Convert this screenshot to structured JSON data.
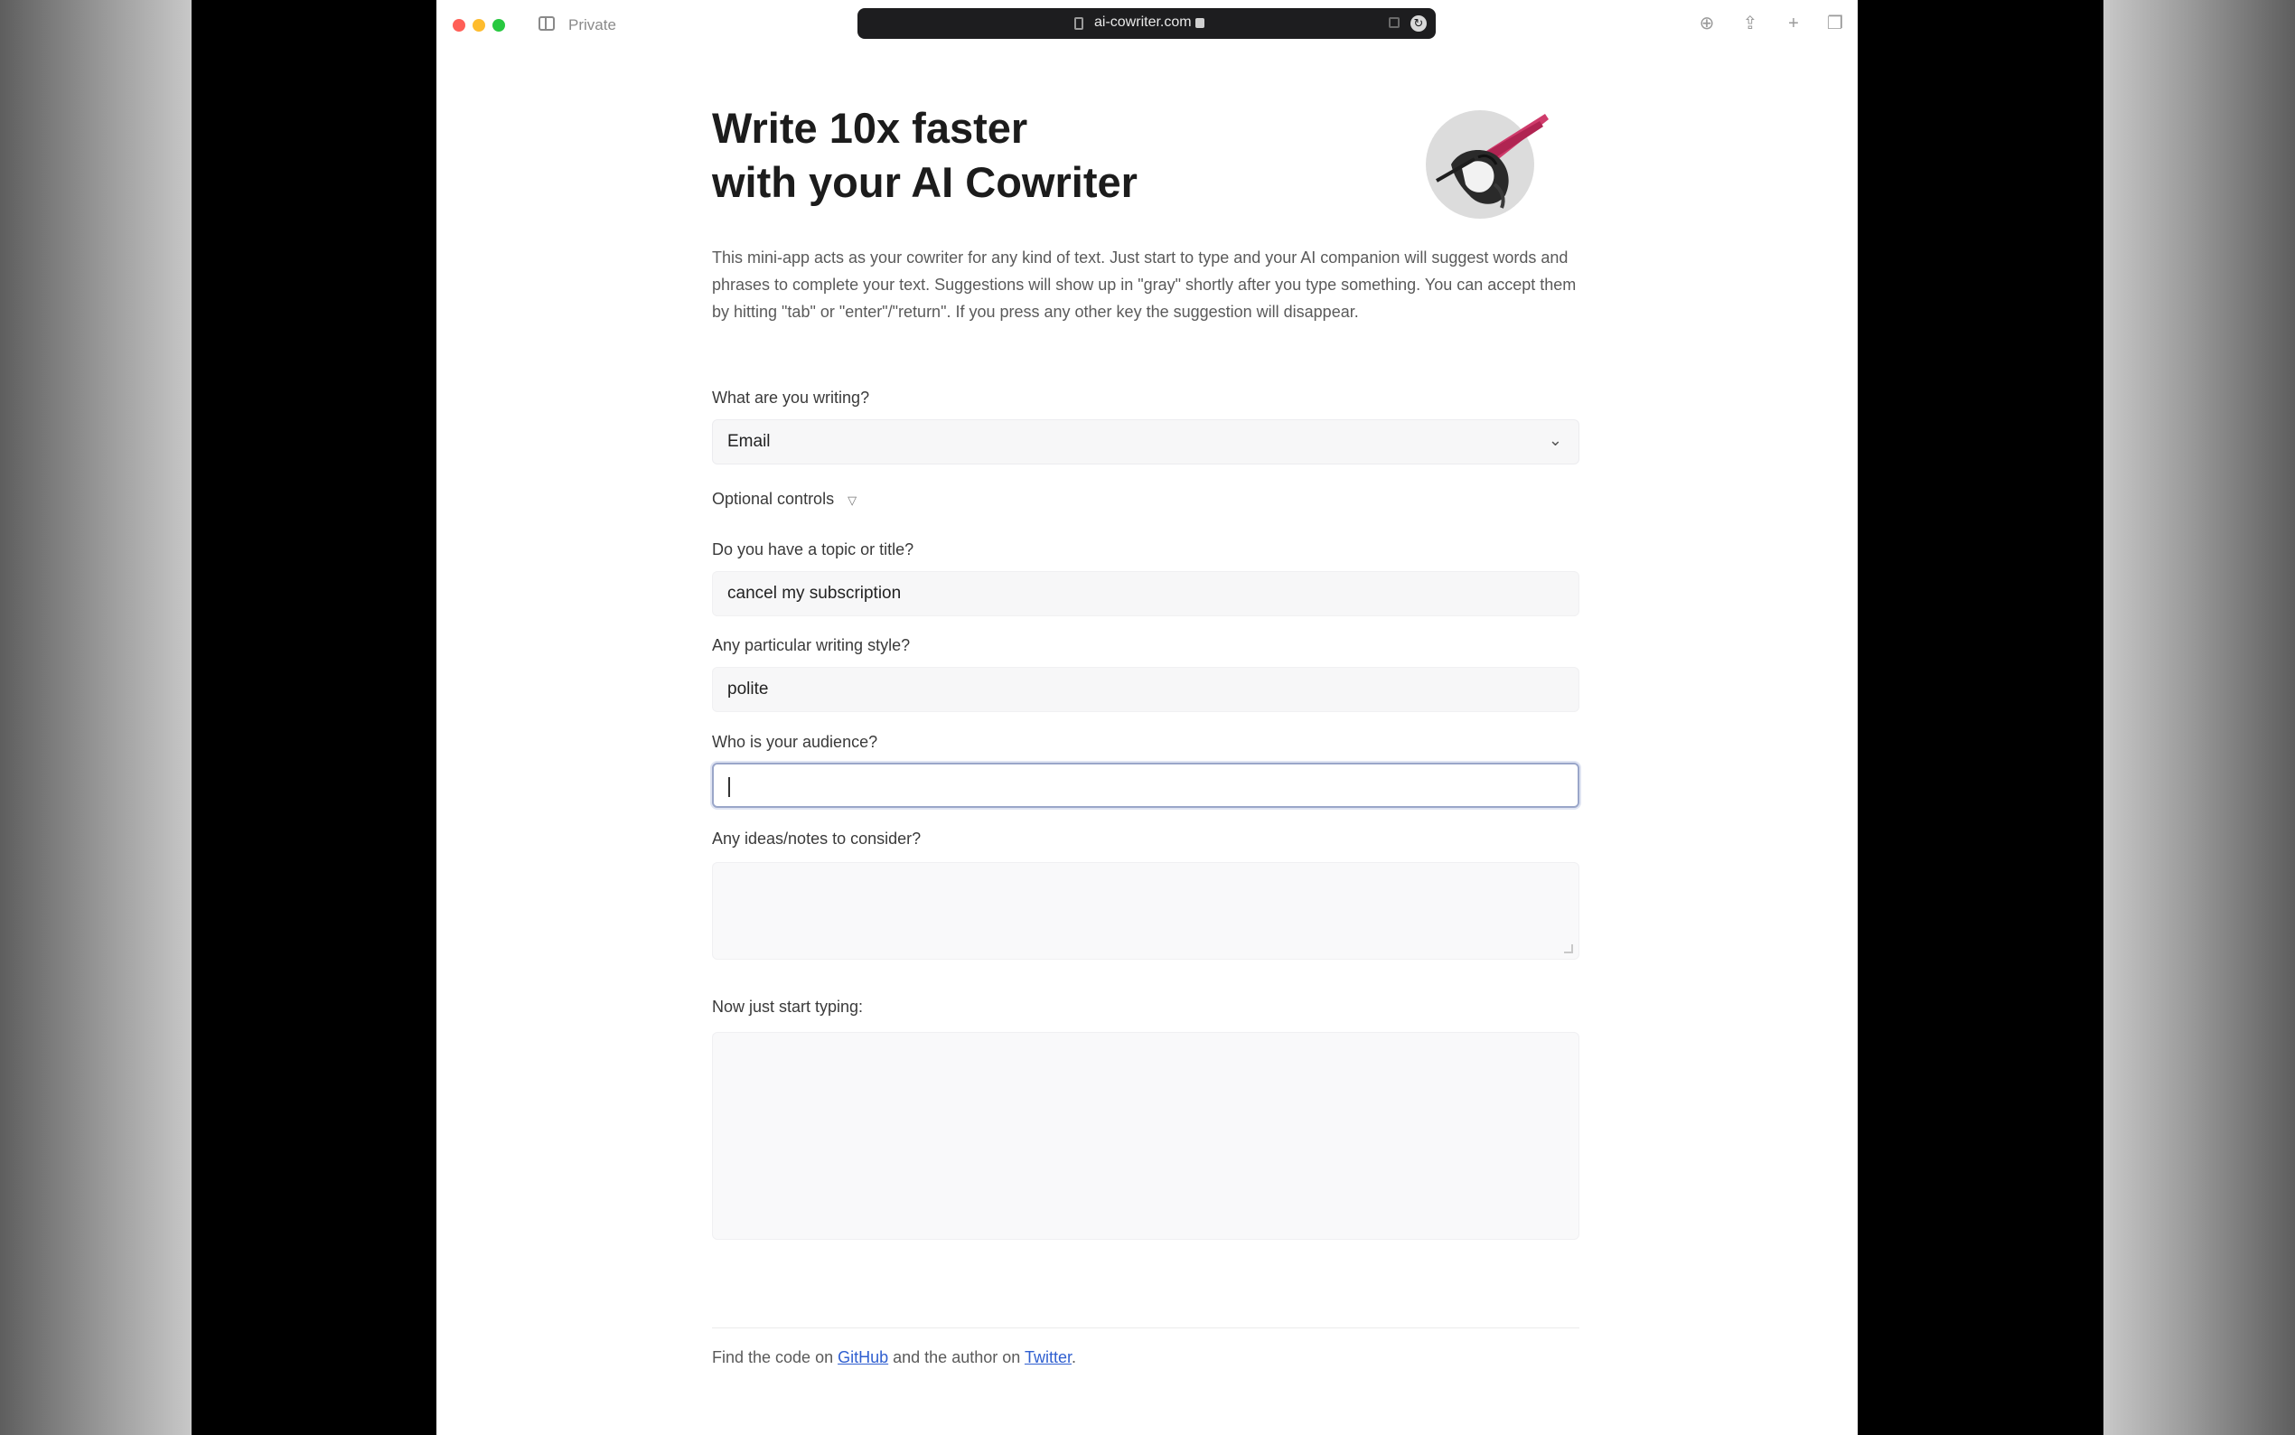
{
  "browser": {
    "private_label": "Private",
    "url": "ai-cowriter.com"
  },
  "page": {
    "headline": "Write 10x faster\nwith your AI Cowriter",
    "intro": "This mini-app acts as your cowriter for any kind of text. Just start to type and your AI companion will suggest words and phrases to complete your text. Suggestions will show up in \"gray\" shortly after you type something. You can accept them by hitting \"tab\" or \"enter\"/\"return\". If you press any other key the suggestion will disappear.",
    "writing_type": {
      "label": "What are you writing?",
      "value": "Email"
    },
    "optional_controls": {
      "label": "Optional controls",
      "toggle": "▽"
    },
    "topic": {
      "label": "Do you have a topic or title?",
      "value": "cancel my subscription"
    },
    "style": {
      "label": "Any particular writing style?",
      "value": "polite"
    },
    "audience": {
      "label": "Who is your audience?",
      "value": ""
    },
    "ideas": {
      "label": "Any ideas/notes to consider?",
      "value": ""
    },
    "editor": {
      "label": "Now just start typing:",
      "value": ""
    },
    "footer": {
      "prefix": "Find the code on ",
      "github_link": "GitHub",
      "middle": " and the author on ",
      "twitter_link": "Twitter",
      "suffix": "."
    }
  },
  "colors": {
    "accent_focus": "#9aa6c9",
    "link": "#2f5fd0"
  },
  "icons": [
    "sidebar-icon",
    "shield-icon",
    "lock-icon",
    "extension-icon",
    "reload-icon",
    "download-icon",
    "share-icon",
    "new-tab-icon",
    "tabs-overview-icon",
    "chevron-down-icon",
    "disclosure-triangle-icon"
  ]
}
